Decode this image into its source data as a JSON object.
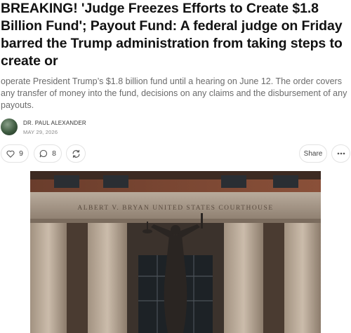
{
  "article": {
    "headline": "BREAKING! 'Judge Freezes Efforts to Create $1.8 Billion Fund'; Payout Fund: A federal judge on Friday barred the Trump administration from taking steps to create or",
    "subtitle": "operate President Trump’s $1.8 billion fund until a hearing on June 12. The order covers any transfer of money into the fund, decisions on any claims and the disbursement of any payouts.",
    "author": "DR. PAUL ALEXANDER",
    "date": "MAY 29, 2026"
  },
  "actions": {
    "like_count": "9",
    "comment_count": "8",
    "share_label": "Share"
  },
  "hero": {
    "inscription": "ALBERT V. BRYAN UNITED STATES COURTHOUSE"
  },
  "icons": {
    "like": "heart-icon",
    "comment": "comment-bubble-icon",
    "restack": "restack-icon",
    "more": "more-dots-icon"
  }
}
